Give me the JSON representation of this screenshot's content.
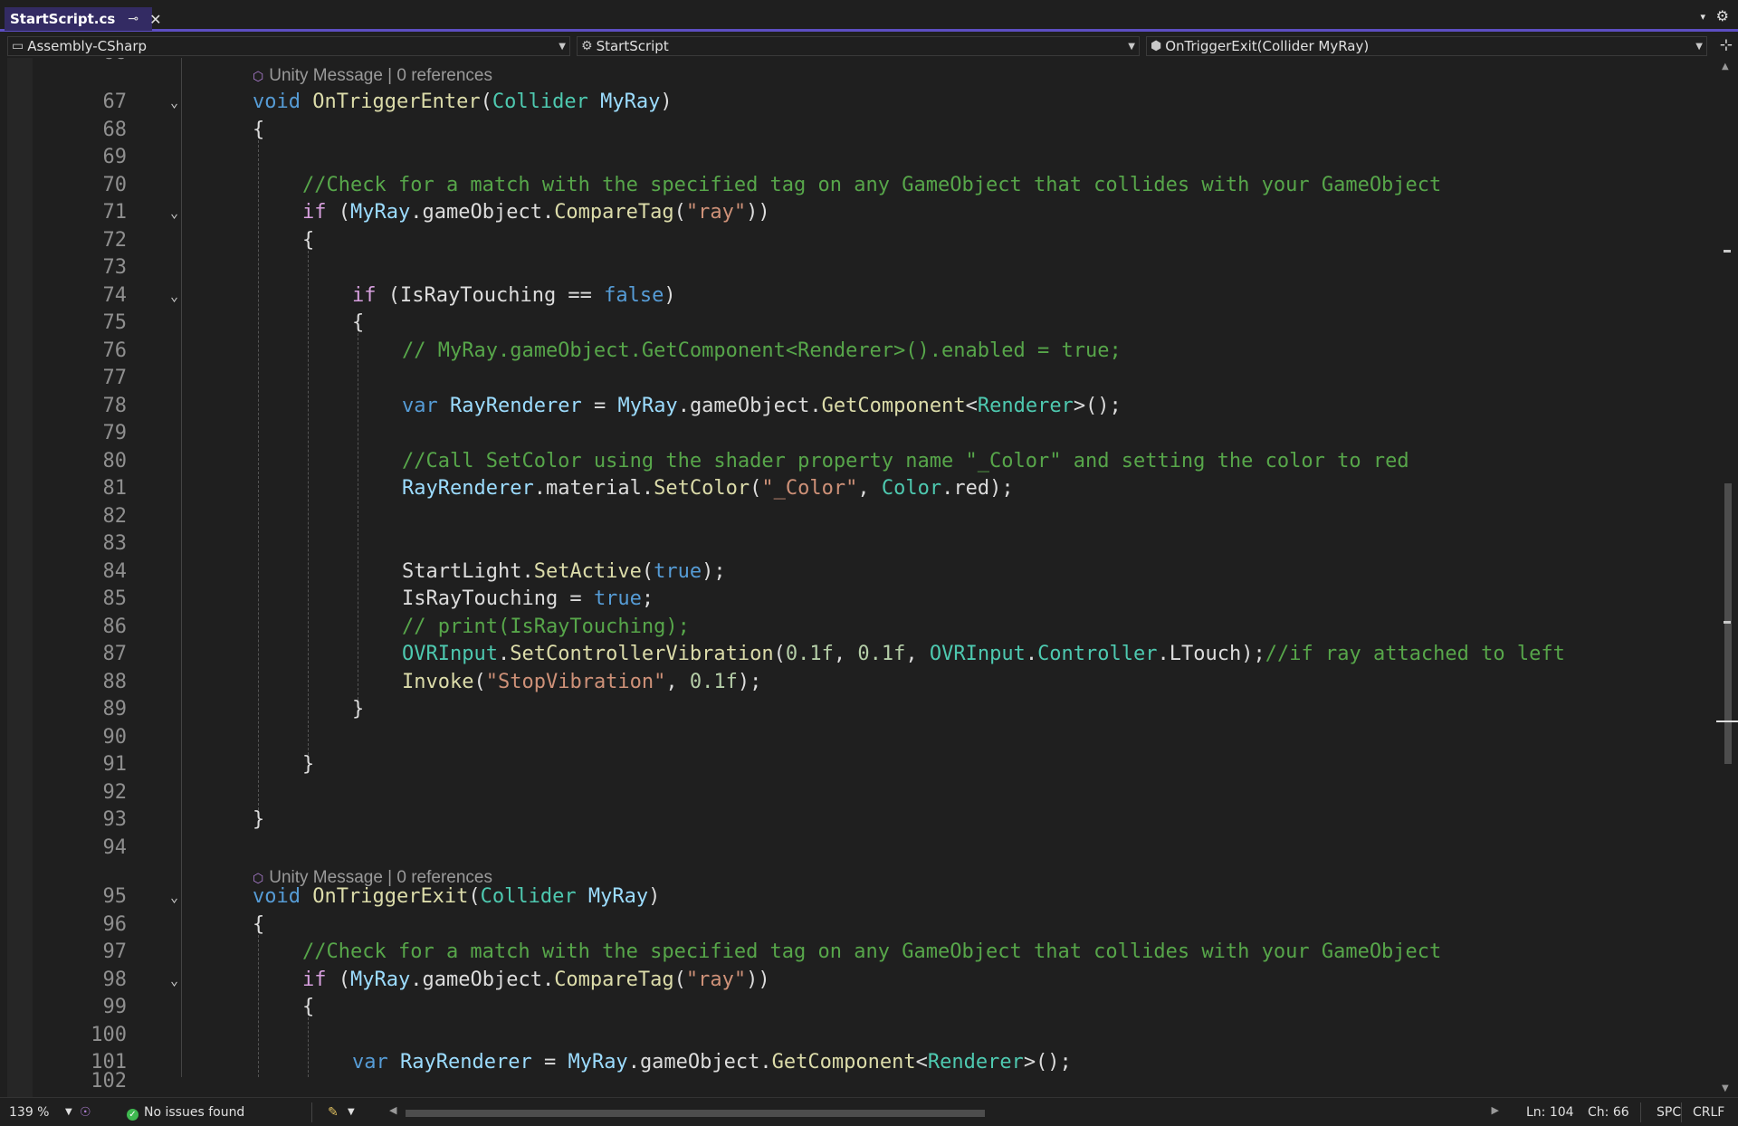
{
  "tab": {
    "title": "StartScript.cs",
    "pin": "⊸",
    "close": "✕"
  },
  "tabbar": {
    "menu": "▾",
    "settings": "⚙"
  },
  "navbar": {
    "project": "Assembly-CSharp",
    "class": "StartScript",
    "member": "OnTriggerExit(Collider MyRay)"
  },
  "codelens": [
    {
      "label": "Unity Message | 0 references"
    },
    {
      "label": "Unity Message | 0 references"
    }
  ],
  "partial_top_line": "66",
  "partial_bottom_line": "102",
  "lines": [
    {
      "n": "67",
      "fold": true,
      "indent": 0,
      "tokens": [
        [
          "kw",
          "void"
        ],
        [
          "p",
          " "
        ],
        [
          "method",
          "OnTriggerEnter"
        ],
        [
          "p",
          "("
        ],
        [
          "type",
          "Collider"
        ],
        [
          "p",
          " "
        ],
        [
          "param",
          "MyRay"
        ],
        [
          "p",
          ")"
        ]
      ]
    },
    {
      "n": "68",
      "fold": false,
      "indent": 0,
      "tokens": [
        [
          "p",
          "{"
        ]
      ]
    },
    {
      "n": "69",
      "fold": false,
      "indent": 0,
      "tokens": []
    },
    {
      "n": "70",
      "fold": false,
      "indent": 1,
      "tokens": [
        [
          "com",
          "//Check for a match with the specified tag on any GameObject that collides with your GameObject"
        ]
      ]
    },
    {
      "n": "71",
      "fold": true,
      "indent": 1,
      "tokens": [
        [
          "ctl",
          "if"
        ],
        [
          "p",
          " ("
        ],
        [
          "param",
          "MyRay"
        ],
        [
          "p",
          "."
        ],
        [
          "field",
          "gameObject"
        ],
        [
          "p",
          "."
        ],
        [
          "method",
          "CompareTag"
        ],
        [
          "p",
          "("
        ],
        [
          "str",
          "\"ray\""
        ],
        [
          "p",
          "))"
        ]
      ]
    },
    {
      "n": "72",
      "fold": false,
      "indent": 1,
      "tokens": [
        [
          "p",
          "{"
        ]
      ]
    },
    {
      "n": "73",
      "fold": false,
      "indent": 1,
      "tokens": []
    },
    {
      "n": "74",
      "fold": true,
      "indent": 2,
      "tokens": [
        [
          "ctl",
          "if"
        ],
        [
          "p",
          " ("
        ],
        [
          "field",
          "IsRayTouching"
        ],
        [
          "p",
          " == "
        ],
        [
          "kw",
          "false"
        ],
        [
          "p",
          ")"
        ]
      ]
    },
    {
      "n": "75",
      "fold": false,
      "indent": 2,
      "tokens": [
        [
          "p",
          "{"
        ]
      ]
    },
    {
      "n": "76",
      "fold": false,
      "indent": 3,
      "tokens": [
        [
          "com",
          "// MyRay.gameObject.GetComponent<Renderer>().enabled = true;"
        ]
      ]
    },
    {
      "n": "77",
      "fold": false,
      "indent": 3,
      "tokens": []
    },
    {
      "n": "78",
      "fold": false,
      "indent": 3,
      "tokens": [
        [
          "kw",
          "var"
        ],
        [
          "p",
          " "
        ],
        [
          "param",
          "RayRenderer"
        ],
        [
          "p",
          " = "
        ],
        [
          "param",
          "MyRay"
        ],
        [
          "p",
          "."
        ],
        [
          "field",
          "gameObject"
        ],
        [
          "p",
          "."
        ],
        [
          "method",
          "GetComponent"
        ],
        [
          "p",
          "<"
        ],
        [
          "type",
          "Renderer"
        ],
        [
          "p",
          ">();"
        ]
      ]
    },
    {
      "n": "79",
      "fold": false,
      "indent": 3,
      "tokens": []
    },
    {
      "n": "80",
      "fold": false,
      "indent": 3,
      "tokens": [
        [
          "com",
          "//Call SetColor using the shader property name \"_Color\" and setting the color to red"
        ]
      ]
    },
    {
      "n": "81",
      "fold": false,
      "indent": 3,
      "tokens": [
        [
          "param",
          "RayRenderer"
        ],
        [
          "p",
          "."
        ],
        [
          "field",
          "material"
        ],
        [
          "p",
          "."
        ],
        [
          "method",
          "SetColor"
        ],
        [
          "p",
          "("
        ],
        [
          "str",
          "\"_Color\""
        ],
        [
          "p",
          ", "
        ],
        [
          "type",
          "Color"
        ],
        [
          "p",
          "."
        ],
        [
          "field",
          "red"
        ],
        [
          "p",
          ");"
        ]
      ]
    },
    {
      "n": "82",
      "fold": false,
      "indent": 3,
      "tokens": []
    },
    {
      "n": "83",
      "fold": false,
      "indent": 3,
      "tokens": []
    },
    {
      "n": "84",
      "fold": false,
      "indent": 3,
      "tokens": [
        [
          "field",
          "StartLight"
        ],
        [
          "p",
          "."
        ],
        [
          "method",
          "SetActive"
        ],
        [
          "p",
          "("
        ],
        [
          "kw",
          "true"
        ],
        [
          "p",
          ");"
        ]
      ]
    },
    {
      "n": "85",
      "fold": false,
      "indent": 3,
      "tokens": [
        [
          "field",
          "IsRayTouching"
        ],
        [
          "p",
          " = "
        ],
        [
          "kw",
          "true"
        ],
        [
          "p",
          ";"
        ]
      ]
    },
    {
      "n": "86",
      "fold": false,
      "indent": 3,
      "tokens": [
        [
          "com",
          "// print(IsRayTouching);"
        ]
      ]
    },
    {
      "n": "87",
      "fold": false,
      "indent": 3,
      "tokens": [
        [
          "type",
          "OVRInput"
        ],
        [
          "p",
          "."
        ],
        [
          "method",
          "SetControllerVibration"
        ],
        [
          "p",
          "("
        ],
        [
          "num",
          "0.1f"
        ],
        [
          "p",
          ", "
        ],
        [
          "num",
          "0.1f"
        ],
        [
          "p",
          ", "
        ],
        [
          "type",
          "OVRInput"
        ],
        [
          "p",
          "."
        ],
        [
          "type",
          "Controller"
        ],
        [
          "p",
          "."
        ],
        [
          "field",
          "LTouch"
        ],
        [
          "p",
          ");"
        ],
        [
          "com",
          "//if ray attached to left"
        ]
      ]
    },
    {
      "n": "88",
      "fold": false,
      "indent": 3,
      "tokens": [
        [
          "method",
          "Invoke"
        ],
        [
          "p",
          "("
        ],
        [
          "str",
          "\"StopVibration\""
        ],
        [
          "p",
          ", "
        ],
        [
          "num",
          "0.1f"
        ],
        [
          "p",
          ");"
        ]
      ]
    },
    {
      "n": "89",
      "fold": false,
      "indent": 2,
      "tokens": [
        [
          "p",
          "}"
        ]
      ]
    },
    {
      "n": "90",
      "fold": false,
      "indent": 2,
      "tokens": []
    },
    {
      "n": "91",
      "fold": false,
      "indent": 1,
      "tokens": [
        [
          "p",
          "}"
        ]
      ]
    },
    {
      "n": "92",
      "fold": false,
      "indent": 1,
      "tokens": []
    },
    {
      "n": "93",
      "fold": false,
      "indent": 0,
      "tokens": [
        [
          "p",
          "}"
        ]
      ]
    },
    {
      "n": "94",
      "fold": false,
      "indent": 0,
      "tokens": []
    },
    {
      "n": "95",
      "fold": true,
      "indent": 0,
      "tokens": [
        [
          "kw",
          "void"
        ],
        [
          "p",
          " "
        ],
        [
          "method",
          "OnTriggerExit"
        ],
        [
          "p",
          "("
        ],
        [
          "type",
          "Collider"
        ],
        [
          "p",
          " "
        ],
        [
          "param",
          "MyRay"
        ],
        [
          "p",
          ")"
        ]
      ]
    },
    {
      "n": "96",
      "fold": false,
      "indent": 0,
      "tokens": [
        [
          "p",
          "{"
        ]
      ]
    },
    {
      "n": "97",
      "fold": false,
      "indent": 1,
      "tokens": [
        [
          "com",
          "//Check for a match with the specified tag on any GameObject that collides with your GameObject"
        ]
      ]
    },
    {
      "n": "98",
      "fold": true,
      "indent": 1,
      "tokens": [
        [
          "ctl",
          "if"
        ],
        [
          "p",
          " ("
        ],
        [
          "param",
          "MyRay"
        ],
        [
          "p",
          "."
        ],
        [
          "field",
          "gameObject"
        ],
        [
          "p",
          "."
        ],
        [
          "method",
          "CompareTag"
        ],
        [
          "p",
          "("
        ],
        [
          "str",
          "\"ray\""
        ],
        [
          "p",
          "))"
        ]
      ]
    },
    {
      "n": "99",
      "fold": false,
      "indent": 1,
      "tokens": [
        [
          "p",
          "{"
        ]
      ]
    },
    {
      "n": "100",
      "fold": false,
      "indent": 1,
      "tokens": []
    },
    {
      "n": "101",
      "fold": false,
      "indent": 2,
      "tokens": [
        [
          "kw",
          "var"
        ],
        [
          "p",
          " "
        ],
        [
          "param",
          "RayRenderer"
        ],
        [
          "p",
          " = "
        ],
        [
          "param",
          "MyRay"
        ],
        [
          "p",
          "."
        ],
        [
          "field",
          "gameObject"
        ],
        [
          "p",
          "."
        ],
        [
          "method",
          "GetComponent"
        ],
        [
          "p",
          "<"
        ],
        [
          "type",
          "Renderer"
        ],
        [
          "p",
          ">();"
        ]
      ]
    }
  ],
  "status": {
    "zoom": "139 %",
    "issues": "No issues found",
    "line": "Ln: 104",
    "col": "Ch: 66",
    "whitespace": "SPC",
    "eol": "CRLF"
  },
  "colors": {
    "keyword": "#569cd6",
    "control": "#d8a0df",
    "type": "#4ec9b0",
    "method": "#dcdcaa",
    "param": "#9cdcfe",
    "string": "#ce9178",
    "comment": "#57a64a",
    "number": "#b5cea8",
    "accent": "#5d4ec2"
  }
}
